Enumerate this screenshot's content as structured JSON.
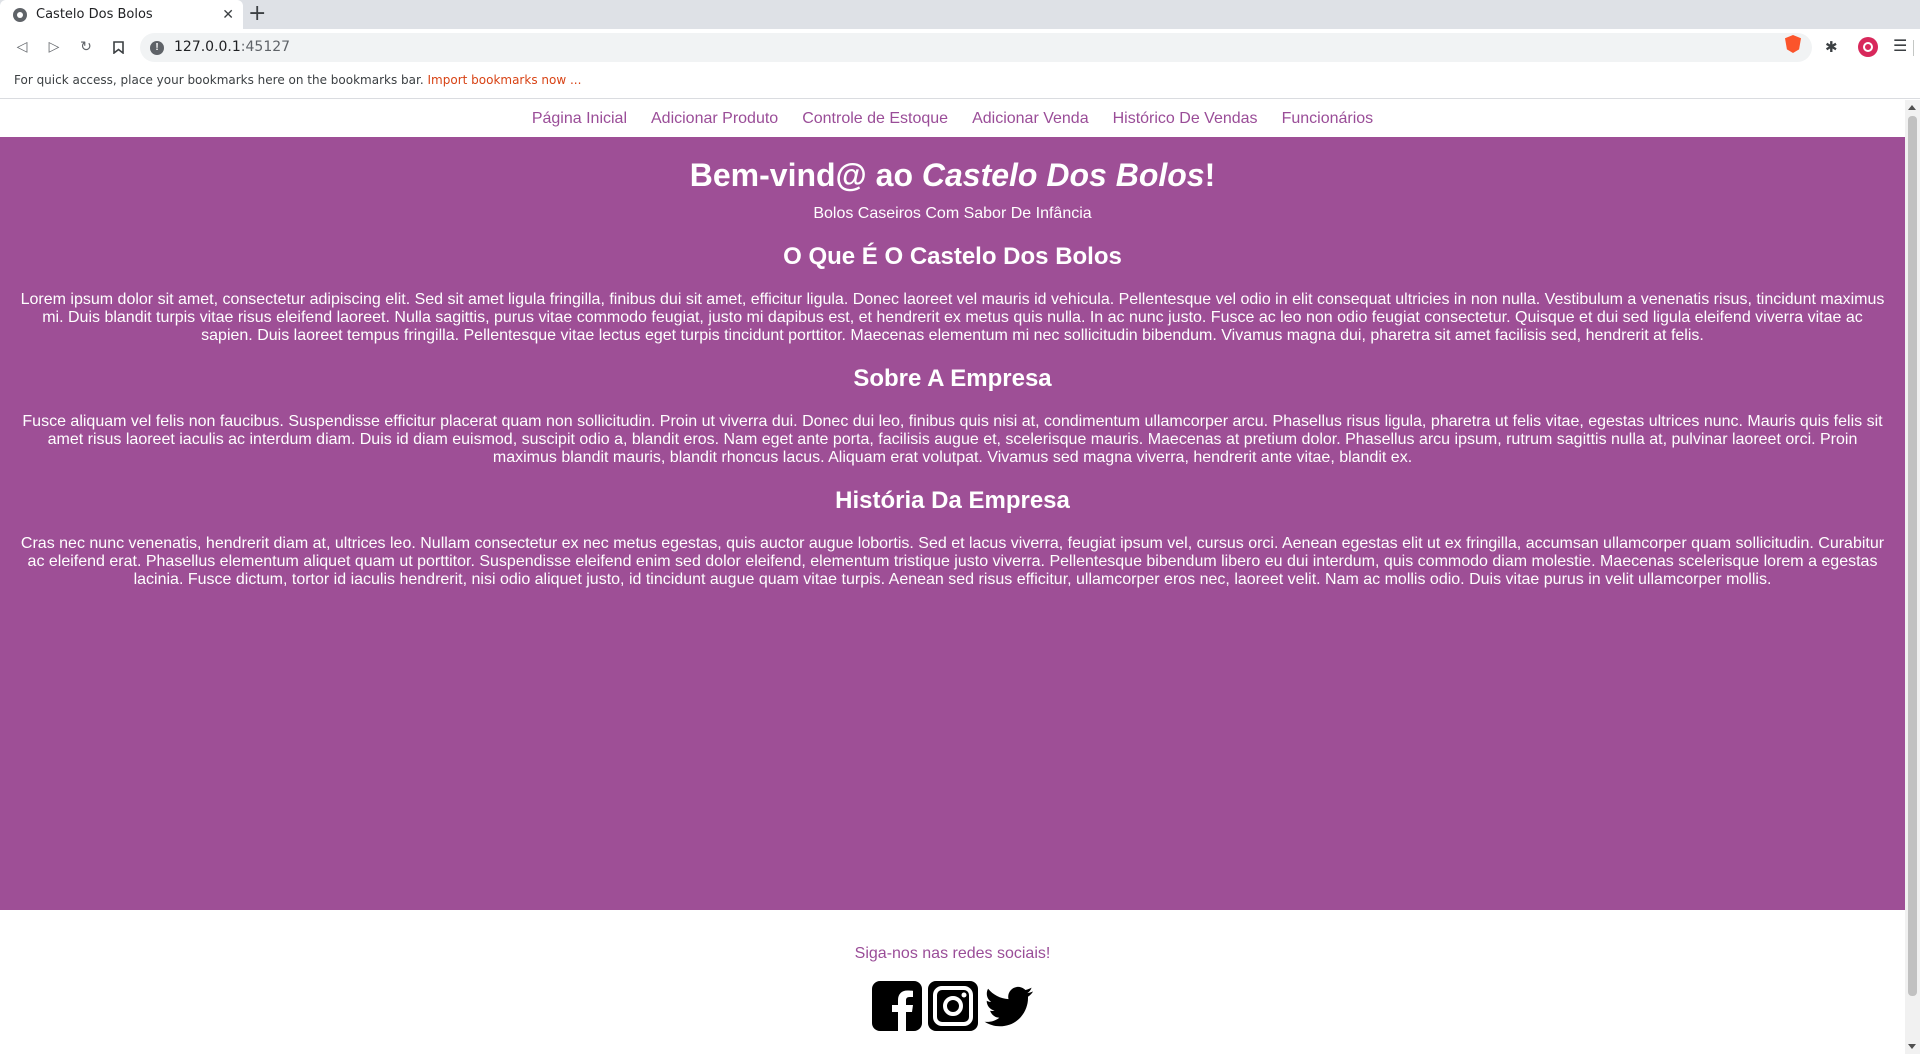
{
  "browser": {
    "tab_title": "Castelo Dos Bolos",
    "tab_close": "✕",
    "new_tab": "+",
    "url_host": "127.0.0.1",
    "url_port": ":45127",
    "bookmarks_prompt": "For quick access, place your bookmarks here on the bookmarks bar.",
    "bookmarks_import": "Import bookmarks now ..."
  },
  "nav": {
    "items": [
      {
        "label": "Página Inicial"
      },
      {
        "label": "Adicionar Produto"
      },
      {
        "label": "Controle de Estoque"
      },
      {
        "label": "Adicionar Venda"
      },
      {
        "label": "Histórico De Vendas"
      },
      {
        "label": "Funcionários"
      }
    ]
  },
  "hero": {
    "title_prefix": "Bem-vind@ ao ",
    "title_brand": "Castelo Dos Bolos",
    "title_suffix": "!",
    "tagline": "Bolos Caseiros Com Sabor De Infância"
  },
  "sections": [
    {
      "heading": "O Que É O Castelo Dos Bolos",
      "text": "Lorem ipsum dolor sit amet, consectetur adipiscing elit. Sed sit amet ligula fringilla, finibus dui sit amet, efficitur ligula. Donec laoreet vel mauris id vehicula. Pellentesque vel odio in elit consequat ultricies in non nulla. Vestibulum a venenatis risus, tincidunt maximus mi. Duis blandit turpis vitae risus eleifend laoreet. Nulla sagittis, purus vitae commodo feugiat, justo mi dapibus est, et hendrerit ex metus quis nulla. In ac nunc justo. Fusce ac leo non odio feugiat consectetur. Quisque et dui sed ligula eleifend viverra vitae ac sapien. Duis laoreet tempus fringilla. Pellentesque vitae lectus eget turpis tincidunt porttitor. Maecenas elementum mi nec sollicitudin bibendum. Vivamus magna dui, pharetra sit amet facilisis sed, hendrerit at felis."
    },
    {
      "heading": "Sobre A Empresa",
      "text": "Fusce aliquam vel felis non faucibus. Suspendisse efficitur placerat quam non sollicitudin. Proin ut viverra dui. Donec dui leo, finibus quis nisi at, condimentum ullamcorper arcu. Phasellus risus ligula, pharetra ut felis vitae, egestas ultrices nunc. Mauris quis felis sit amet risus laoreet iaculis ac interdum diam. Duis id diam euismod, suscipit odio a, blandit eros. Nam eget ante porta, facilisis augue et, scelerisque mauris. Maecenas at pretium dolor. Phasellus arcu ipsum, rutrum sagittis nulla at, pulvinar laoreet orci. Proin maximus blandit mauris, blandit rhoncus lacus. Aliquam erat volutpat. Vivamus sed magna viverra, hendrerit ante vitae, blandit ex."
    },
    {
      "heading": "História Da Empresa",
      "text": "Cras nec nunc venenatis, hendrerit diam at, ultrices leo. Nullam consectetur ex nec metus egestas, quis auctor augue lobortis. Sed et lacus viverra, feugiat ipsum vel, cursus orci. Aenean egestas elit ut ex fringilla, accumsan ullamcorper quam sollicitudin. Curabitur ac eleifend erat. Phasellus elementum aliquet quam ut porttitor. Suspendisse eleifend enim sed dolor eleifend, elementum tristique justo viverra. Pellentesque bibendum libero eu dui interdum, quis commodo diam molestie. Maecenas scelerisque lorem a egestas lacinia. Fusce dictum, tortor id iaculis hendrerit, nisi odio aliquet justo, id tincidunt augue quam vitae turpis. Aenean sed risus efficitur, ullamcorper eros nec, laoreet velit. Nam ac mollis odio. Duis vitae purus in velit ullamcorper mollis."
    }
  ],
  "footer": {
    "text": "Siga-nos nas redes sociais!",
    "icons": [
      "facebook-icon",
      "instagram-icon",
      "twitter-icon"
    ]
  },
  "colors": {
    "brand_purple": "#9e4f96",
    "link_purple": "#9a4d98"
  }
}
